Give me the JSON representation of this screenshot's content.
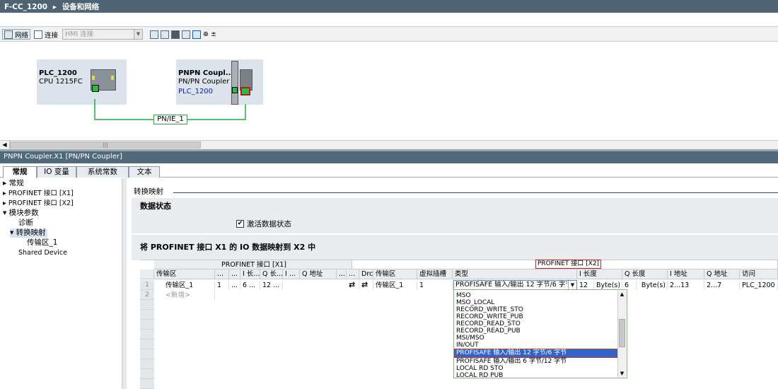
{
  "titlebar": {
    "project": "F-CC_1200",
    "separator": "▸",
    "page": "设备和网络"
  },
  "toolbar": {
    "network_label": "网络",
    "connection_label": "连接",
    "hmi_select_value": "HMI 连接",
    "zoom_label": "⊕ ±"
  },
  "devices": [
    {
      "name": "PLC_1200",
      "type": "CPU 1215FC"
    },
    {
      "name": "PNPN Coupl...",
      "type": "PN/PN Coupler",
      "link": "PLC_1200"
    }
  ],
  "network": {
    "label": "PN/IE_1"
  },
  "inspector": {
    "title": "PNPN Coupler.X1 [PN/PN Coupler]"
  },
  "tabs": [
    "常规",
    "IO 变量",
    "系统常数",
    "文本"
  ],
  "nav": {
    "items": [
      {
        "label": "常规",
        "arrow": "▸"
      },
      {
        "label": "PROFINET 接口 [X1]",
        "arrow": "▸"
      },
      {
        "label": "PROFINET 接口 [X2]",
        "arrow": "▸"
      },
      {
        "label": "模块参数",
        "arrow": "▾"
      },
      {
        "label": "诊断",
        "arrow": ""
      },
      {
        "label": "转换映射",
        "arrow": "▾"
      },
      {
        "label": "传输区_1",
        "arrow": ""
      },
      {
        "label": "Shared Device",
        "arrow": ""
      }
    ]
  },
  "content": {
    "section_title": "转换映射",
    "data_status_title": "数据状态",
    "checkbox_label": "激活数据状态",
    "checkbox_checked": true,
    "mapping_title": "将 PROFINET 接口 X1 的 IO 数据映射到 X2 中"
  },
  "grid": {
    "group_x1": "PROFINET 接口 [X1]",
    "group_x2": "PROFINET 接口 [X2]",
    "headers_left": [
      "传输区",
      "...",
      "...",
      "I 长...",
      "Q 长...",
      "I ...",
      "Q 地址",
      "..."
    ],
    "headers_right": [
      "...",
      "Drc",
      "传输区",
      "虚拟插槽",
      "类型",
      "I 长度",
      "Q 长度",
      "I 地址",
      "Q 地址",
      "访问"
    ],
    "row1": {
      "num": "1",
      "left": [
        "传输区_1",
        "1",
        "...",
        "6 ...",
        "12 ...",
        "",
        "",
        ""
      ],
      "right": [
        "⇄",
        "⇄",
        "传输区_1",
        "1",
        "PROFISAFE 输入/输出 12 字节/6 字节",
        "12",
        "Byte(s)",
        "6",
        "Byte(s)",
        "2...13",
        "2...7",
        "PLC_1200"
      ]
    },
    "row2": {
      "num": "2",
      "placeholder": "<新增>"
    }
  },
  "dropdown": {
    "items": [
      "MSO",
      "MSO_LOCAL",
      "RECORD_WRITE_STO",
      "RECORD_WRITE_PUB",
      "RECORD_READ_STO",
      "RECORD_READ_PUB",
      "MSI/MSO",
      "IN/OUT",
      "PROFISAFE 输入/输出 12 字节/6 字节",
      "PROFISAFE 输入/输出 6 字节/12 字节",
      "LOCAL RD STO",
      "LOCAL RD PUB"
    ],
    "selected_index": 8
  }
}
